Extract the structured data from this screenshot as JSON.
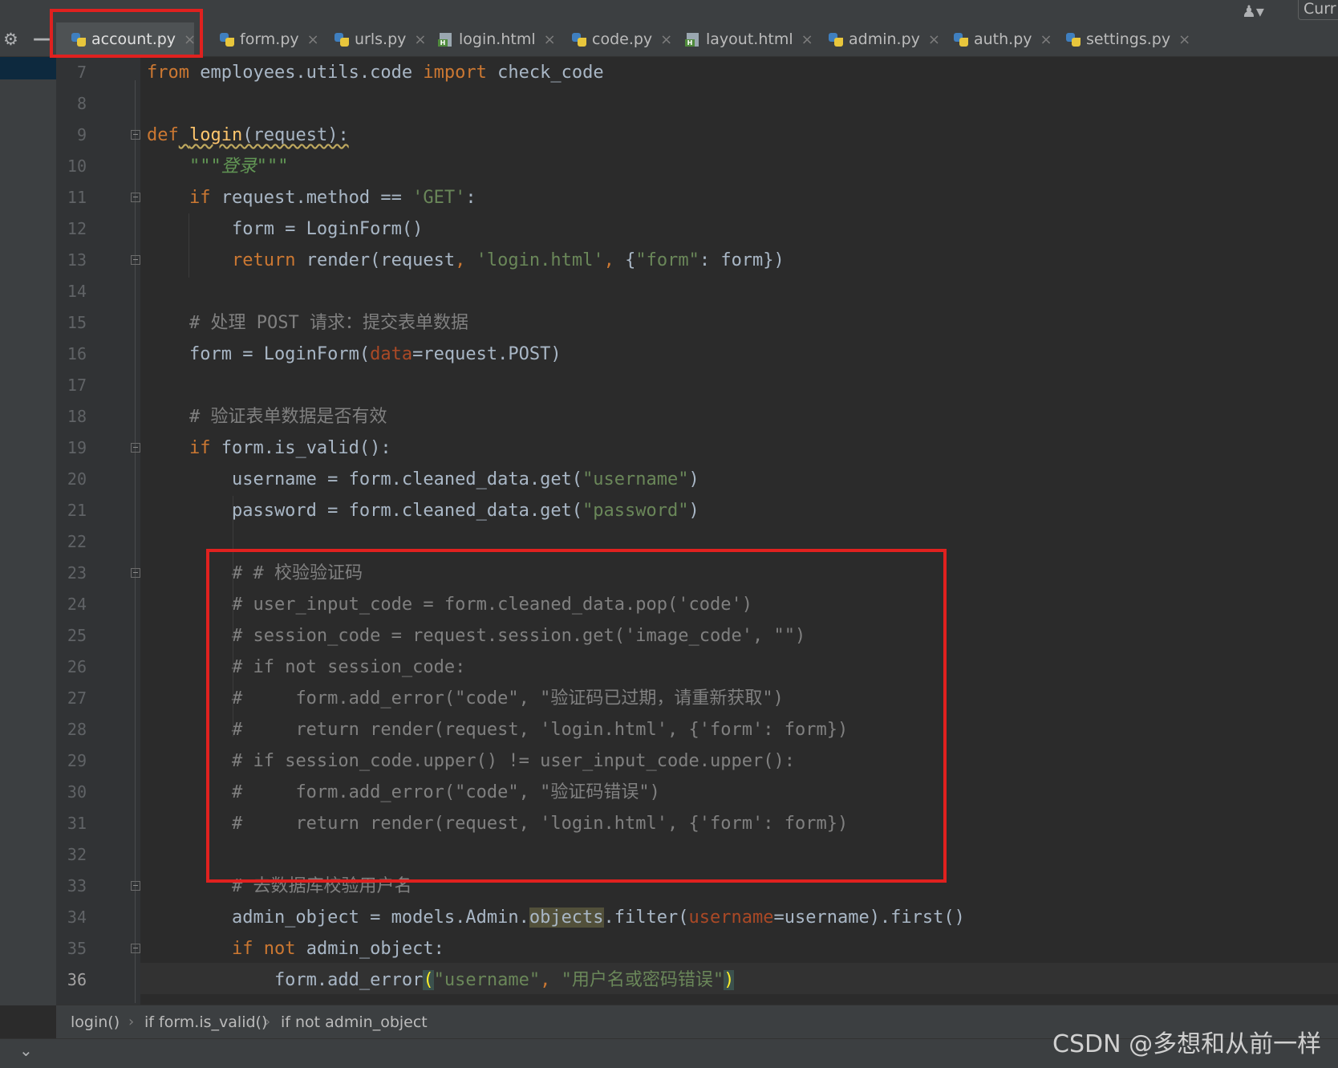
{
  "top": {
    "user_icon": "user-icon",
    "curr_label": "Curr"
  },
  "tabs": [
    {
      "label": "account.py",
      "kind": "py",
      "active": true
    },
    {
      "label": "form.py",
      "kind": "py"
    },
    {
      "label": "urls.py",
      "kind": "py"
    },
    {
      "label": "login.html",
      "kind": "html"
    },
    {
      "label": "code.py",
      "kind": "py"
    },
    {
      "label": "layout.html",
      "kind": "html"
    },
    {
      "label": "admin.py",
      "kind": "py"
    },
    {
      "label": "auth.py",
      "kind": "py"
    },
    {
      "label": "settings.py",
      "kind": "py"
    }
  ],
  "editor": {
    "current_line": 36,
    "lines": [
      {
        "n": "7",
        "t": [
          [
            "from",
            "kw"
          ],
          [
            " employees.utils.code ",
            ""
          ],
          [
            "import",
            "kw"
          ],
          [
            " check_code",
            ""
          ]
        ]
      },
      {
        "n": "8",
        "t": []
      },
      {
        "n": "9",
        "t": [
          [
            "def",
            "kw"
          ],
          [
            " ",
            ""
          ],
          [
            "login",
            "fn"
          ],
          [
            "(request):",
            ""
          ]
        ]
      },
      {
        "n": "10",
        "t": [
          [
            "    ",
            ""
          ],
          [
            "\"\"\"登录\"\"\"",
            "doc"
          ]
        ]
      },
      {
        "n": "11",
        "t": [
          [
            "    ",
            ""
          ],
          [
            "if",
            "kw"
          ],
          [
            " request.method == ",
            ""
          ],
          [
            "'GET'",
            "str"
          ],
          [
            ":",
            ""
          ]
        ]
      },
      {
        "n": "12",
        "t": [
          [
            "        form = LoginForm()",
            ""
          ]
        ]
      },
      {
        "n": "13",
        "t": [
          [
            "        ",
            ""
          ],
          [
            "return",
            "kw"
          ],
          [
            " render(request",
            ""
          ],
          [
            ", ",
            "kw"
          ],
          [
            "'login.html'",
            "str"
          ],
          [
            ", ",
            "kw"
          ],
          [
            "{",
            ""
          ],
          [
            "\"form\"",
            "str"
          ],
          [
            ": form})",
            ""
          ]
        ]
      },
      {
        "n": "14",
        "t": []
      },
      {
        "n": "15",
        "t": [
          [
            "    ",
            ""
          ],
          [
            "# 处理 POST 请求：提交表单数据",
            "cm"
          ]
        ]
      },
      {
        "n": "16",
        "t": [
          [
            "    form = LoginForm(",
            ""
          ],
          [
            "data",
            "par"
          ],
          [
            "=request.POST)",
            ""
          ]
        ]
      },
      {
        "n": "17",
        "t": []
      },
      {
        "n": "18",
        "t": [
          [
            "    ",
            ""
          ],
          [
            "# 验证表单数据是否有效",
            "cm"
          ]
        ]
      },
      {
        "n": "19",
        "t": [
          [
            "    ",
            ""
          ],
          [
            "if",
            "kw"
          ],
          [
            " form.is_valid():",
            ""
          ]
        ]
      },
      {
        "n": "20",
        "t": [
          [
            "        username = form.cleaned_data.get(",
            ""
          ],
          [
            "\"username\"",
            "str"
          ],
          [
            ")",
            ""
          ]
        ]
      },
      {
        "n": "21",
        "t": [
          [
            "        password = form.cleaned_data.get(",
            ""
          ],
          [
            "\"password\"",
            "str"
          ],
          [
            ")",
            ""
          ]
        ]
      },
      {
        "n": "22",
        "t": []
      },
      {
        "n": "23",
        "t": [
          [
            "        ",
            ""
          ],
          [
            "# # 校验验证码",
            "cm"
          ]
        ]
      },
      {
        "n": "24",
        "t": [
          [
            "        ",
            ""
          ],
          [
            "# user_input_code = form.cleaned_data.pop('code')",
            "cm"
          ]
        ]
      },
      {
        "n": "25",
        "t": [
          [
            "        ",
            ""
          ],
          [
            "# session_code = request.session.get('image_code', \"\")",
            "cm"
          ]
        ]
      },
      {
        "n": "26",
        "t": [
          [
            "        ",
            ""
          ],
          [
            "# if not session_code:",
            "cm"
          ]
        ]
      },
      {
        "n": "27",
        "t": [
          [
            "        ",
            ""
          ],
          [
            "#     form.add_error(\"code\", \"验证码已过期，请重新获取\")",
            "cm"
          ]
        ]
      },
      {
        "n": "28",
        "t": [
          [
            "        ",
            ""
          ],
          [
            "#     return render(request, 'login.html', {'form': form})",
            "cm"
          ]
        ]
      },
      {
        "n": "29",
        "t": [
          [
            "        ",
            ""
          ],
          [
            "# if session_code.upper() != user_input_code.upper():",
            "cm"
          ]
        ]
      },
      {
        "n": "30",
        "t": [
          [
            "        ",
            ""
          ],
          [
            "#     form.add_error(\"code\", \"验证码错误\")",
            "cm"
          ]
        ]
      },
      {
        "n": "31",
        "t": [
          [
            "        ",
            ""
          ],
          [
            "#     return render(request, 'login.html', {'form': form})",
            "cm"
          ]
        ]
      },
      {
        "n": "32",
        "t": []
      },
      {
        "n": "33",
        "t": [
          [
            "        ",
            ""
          ],
          [
            "# 去数据库校验用户名",
            "cm"
          ]
        ]
      },
      {
        "n": "34",
        "t": [
          [
            "        admin_object = models.Admin.",
            ""
          ],
          [
            "objects",
            "hl"
          ],
          [
            ".filter(",
            ""
          ],
          [
            "username",
            "par"
          ],
          [
            "=username).first()",
            ""
          ]
        ]
      },
      {
        "n": "35",
        "t": [
          [
            "        ",
            ""
          ],
          [
            "if not",
            "kw"
          ],
          [
            " admin_object:",
            ""
          ]
        ]
      },
      {
        "n": "36",
        "t": [
          [
            "            form.add_error",
            ""
          ],
          [
            "(",
            "br"
          ],
          [
            "\"username\"",
            "str"
          ],
          [
            ", ",
            "kw"
          ],
          [
            "\"用户名或密码错误\"",
            "str"
          ],
          [
            ")",
            "br"
          ]
        ]
      }
    ]
  },
  "breadcrumbs": [
    "login()",
    "if form.is_valid()",
    "if not admin_object"
  ],
  "watermark": "CSDN @多想和从前一样"
}
